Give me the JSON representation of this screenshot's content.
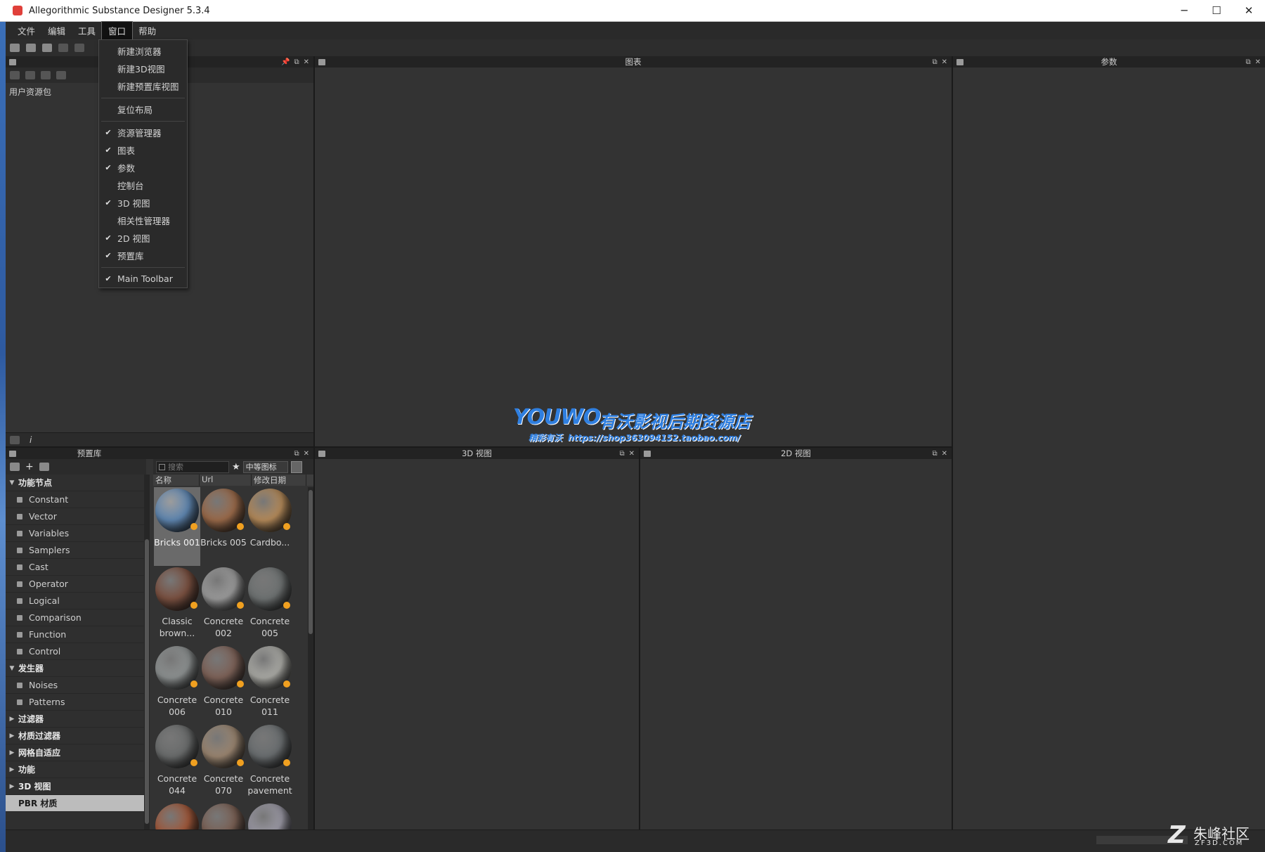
{
  "window": {
    "title": "Allegorithmic Substance Designer 5.3.4",
    "minimize": "─",
    "maximize": "☐",
    "close": "✕"
  },
  "menubar": {
    "items": [
      "文件",
      "编辑",
      "工具",
      "窗口",
      "帮助"
    ],
    "active": "窗口"
  },
  "window_menu": {
    "groups": [
      [
        {
          "label": "新建浏览器",
          "checked": false
        },
        {
          "label": "新建3D视图",
          "checked": false
        },
        {
          "label": "新建预置库视图",
          "checked": false
        }
      ],
      [
        {
          "label": "复位布局",
          "checked": false
        }
      ],
      [
        {
          "label": "资源管理器",
          "checked": true
        },
        {
          "label": "图表",
          "checked": true
        },
        {
          "label": "参数",
          "checked": true
        },
        {
          "label": "控制台",
          "checked": false
        },
        {
          "label": "3D 视图",
          "checked": true
        },
        {
          "label": "相关性管理器",
          "checked": false
        },
        {
          "label": "2D 视图",
          "checked": true
        },
        {
          "label": "预置库",
          "checked": true
        }
      ],
      [
        {
          "label": "Main Toolbar",
          "checked": true
        }
      ]
    ],
    "check_glyph": "✔"
  },
  "explorer": {
    "root_label": "用户资源包",
    "info_glyph": "i"
  },
  "graph": {
    "title": "图表"
  },
  "params": {
    "title": "参数"
  },
  "view3d": {
    "title": "3D 视图"
  },
  "view2d": {
    "title": "2D 视图"
  },
  "panel_buttons": {
    "float": "⧉",
    "close": "✕",
    "pin": "📌"
  },
  "library": {
    "title": "预置库",
    "search_placeholder": "搜索",
    "size_select": "中等图标",
    "star_glyph": "★",
    "columns": [
      "名称",
      "Url",
      "修改日期"
    ],
    "tree": [
      {
        "label": "功能节点",
        "type": "category",
        "expanded": true
      },
      {
        "label": "Constant",
        "type": "node"
      },
      {
        "label": "Vector",
        "type": "node"
      },
      {
        "label": "Variables",
        "type": "node"
      },
      {
        "label": "Samplers",
        "type": "node"
      },
      {
        "label": "Cast",
        "type": "node"
      },
      {
        "label": "Operator",
        "type": "node"
      },
      {
        "label": "Logical",
        "type": "node"
      },
      {
        "label": "Comparison",
        "type": "node"
      },
      {
        "label": "Function",
        "type": "node"
      },
      {
        "label": "Control",
        "type": "node"
      },
      {
        "label": "发生器",
        "type": "category",
        "expanded": true
      },
      {
        "label": "Noises",
        "type": "node"
      },
      {
        "label": "Patterns",
        "type": "node"
      },
      {
        "label": "过滤器",
        "type": "category",
        "expanded": false
      },
      {
        "label": "材质过滤器",
        "type": "category",
        "expanded": false
      },
      {
        "label": "网格自适应",
        "type": "category",
        "expanded": false
      },
      {
        "label": "功能",
        "type": "category",
        "expanded": false
      },
      {
        "label": "3D 视图",
        "type": "category",
        "expanded": false
      },
      {
        "label": "PBR 材质",
        "type": "category",
        "selected": true
      }
    ],
    "materials": [
      {
        "label": "Bricks 001",
        "color": "#5f86b0",
        "selected": true
      },
      {
        "label": "Bricks 005",
        "color": "#9a6a4a"
      },
      {
        "label": "Cardbo...",
        "color": "#b48a5a"
      },
      {
        "label": "Classic brown...",
        "color": "#7a5040"
      },
      {
        "label": "Concrete 002",
        "color": "#9a9a9a"
      },
      {
        "label": "Concrete 005",
        "color": "#6e7272"
      },
      {
        "label": "Concrete 006",
        "color": "#8c9090"
      },
      {
        "label": "Concrete 010",
        "color": "#7d6258"
      },
      {
        "label": "Concrete 011",
        "color": "#a9a9a4"
      },
      {
        "label": "Concrete 044",
        "color": "#6a6c6c"
      },
      {
        "label": "Concrete 070",
        "color": "#9a8570"
      },
      {
        "label": "Concrete pavement",
        "color": "#6a6e70"
      },
      {
        "label": "",
        "color": "#a0583a"
      },
      {
        "label": "",
        "color": "#7a6054"
      },
      {
        "label": "",
        "color": "#9a98a4"
      }
    ]
  },
  "watermark": {
    "logo": "YOUWO",
    "name": "有沃影视后期资源店",
    "slogan": "精彩有沃",
    "url": "https://shop363094152.taobao.com/"
  },
  "brand": {
    "mark": "Z",
    "name": "朱峰社区",
    "site": "ZF3D.COM"
  }
}
